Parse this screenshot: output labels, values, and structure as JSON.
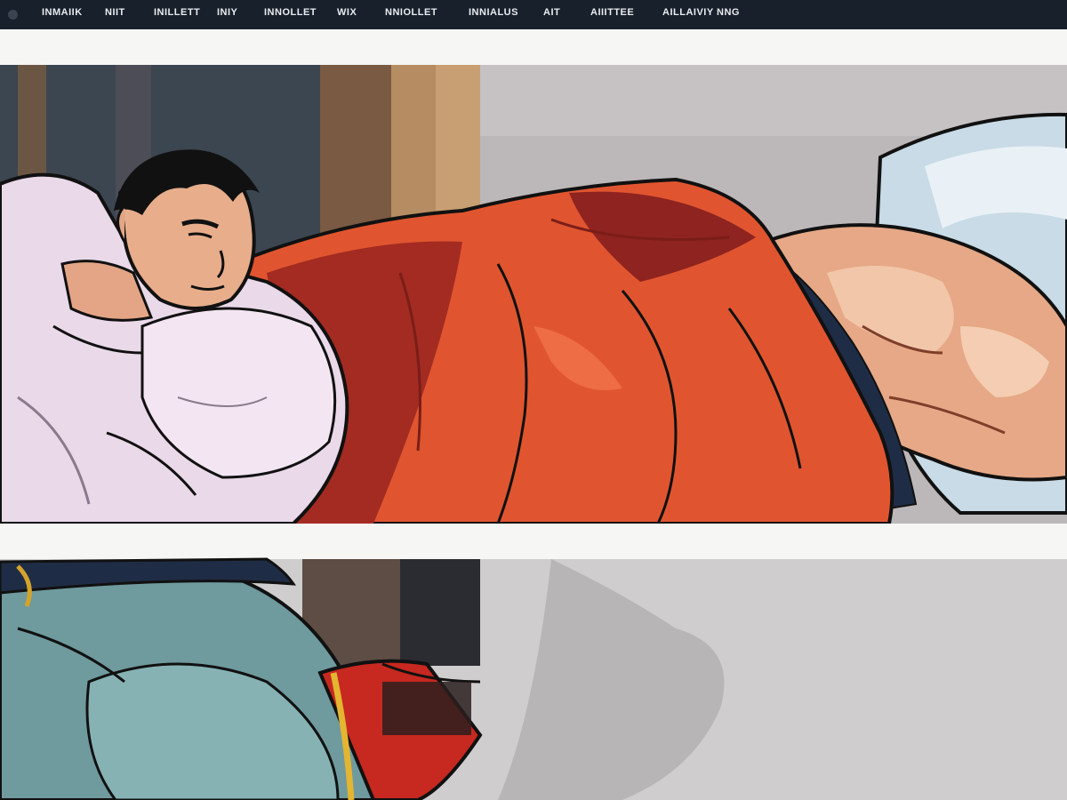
{
  "nav": {
    "items": [
      {
        "label": "INMAIIK"
      },
      {
        "label": "NIIT"
      },
      {
        "label": "INILLETT"
      },
      {
        "label": "INIY"
      },
      {
        "label": "INNOLLET"
      },
      {
        "label": "WIX"
      },
      {
        "label": "NNIOLLET"
      },
      {
        "label": "INNIALUS"
      },
      {
        "label": "AIT"
      },
      {
        "label": "AIIITTEE"
      },
      {
        "label": "AILLAIVIY NNG"
      }
    ]
  },
  "colors": {
    "navbar": "#18202c",
    "nav_text": "#e9ecef",
    "panel_border": "#f6f6f4",
    "robe_red": "#e2552f",
    "shirt_lilac": "#eadcea",
    "skin": "#e8b08f",
    "trousers_teal": "#6f9a9e",
    "background_gray": "#b9b6b8"
  },
  "artwork": {
    "description_icon": "comic-panel-image"
  }
}
